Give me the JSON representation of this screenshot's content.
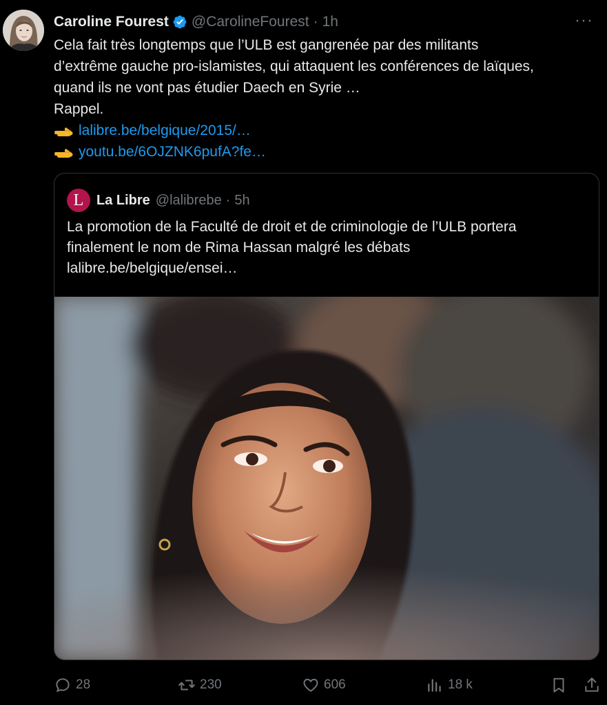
{
  "tweet": {
    "author_name": "Caroline Fourest",
    "author_handle": "@CarolineFourest",
    "separator": "·",
    "time": "1h",
    "more_label": "···",
    "lines": [
      "Cela fait très longtemps que l’ULB est gangrenée par des militants",
      "d’extrême gauche pro-islamistes, qui attaquent les conférences de laïques,",
      "quand ils ne vont pas étudier Daech en Syrie …",
      "Rappel."
    ],
    "links": [
      "lalibre.be/belgique/2015/…",
      "youtu.be/6OJZNK6pufA?fe…"
    ]
  },
  "quote": {
    "logo_letter": "L",
    "author_name": "La Libre",
    "author_handle": "@lalibrebe",
    "separator": "·",
    "time": "5h",
    "lines": [
      "La promotion de la Faculté de droit et de criminologie de l’ULB portera",
      "finalement le nom de Rima Hassan malgré les débats",
      "lalibre.be/belgique/ensei…"
    ]
  },
  "actions": {
    "replies": "28",
    "reposts": "230",
    "likes": "606",
    "views": "18 k"
  },
  "colors": {
    "background": "#000000",
    "text": "#e7e9ea",
    "muted": "#71767b",
    "link": "#1d9bf0",
    "verified": "#1d9bf0",
    "la_libre_brand": "#b3144b",
    "border": "#2f3336"
  },
  "icons": [
    "verified-badge-icon",
    "more-icon",
    "pointing-hand-icon",
    "reply-icon",
    "repost-icon",
    "like-icon",
    "views-icon",
    "bookmark-icon",
    "share-icon"
  ]
}
